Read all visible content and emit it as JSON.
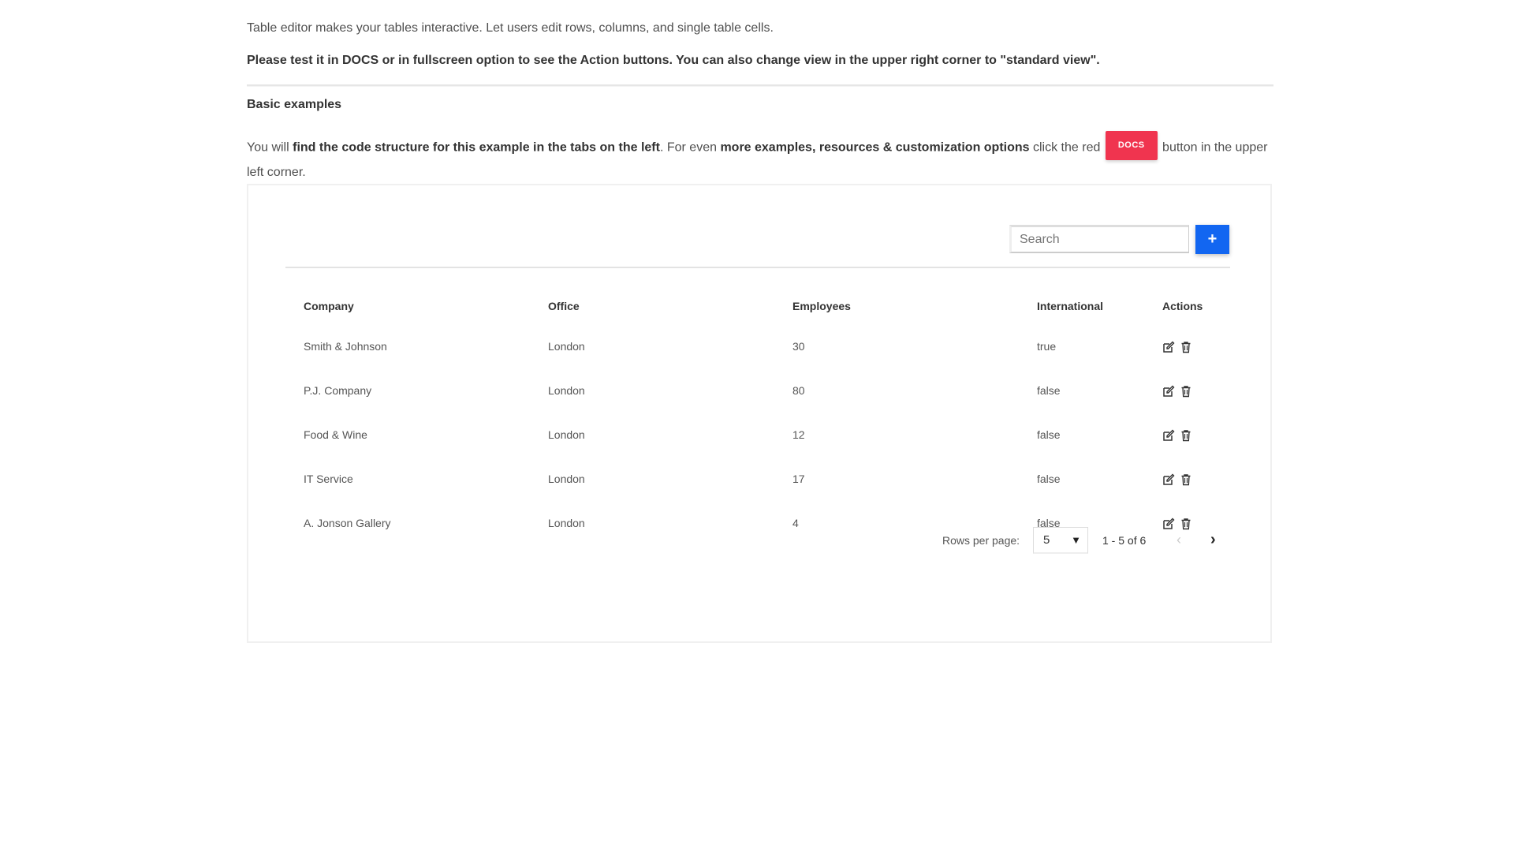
{
  "intro": {
    "line1": "Table editor makes your tables interactive. Let users edit rows, columns, and single table cells.",
    "line2": "Please test it in DOCS or in fullscreen option to see the Action buttons. You can also change view in the upper right corner to \"standard view\"."
  },
  "basic": {
    "heading": "Basic examples",
    "text_a": "You will ",
    "text_b": "find the code structure for this example in the tabs on the left",
    "text_c": ". For even ",
    "text_d": "more examples, resources & customization options",
    "text_e": " click the red ",
    "docs_label": "DOCS",
    "text_f": " button in the upper left corner.",
    "docs_color": "#f0344f"
  },
  "toolbar": {
    "search_placeholder": "Search",
    "add_label": "+",
    "accent": "#1266f1"
  },
  "table": {
    "columns": [
      "Company",
      "Office",
      "Employees",
      "International",
      "Actions"
    ],
    "rows": [
      {
        "company": "Smith & Johnson",
        "office": "London",
        "employees": "30",
        "international": "true"
      },
      {
        "company": "P.J. Company",
        "office": "London",
        "employees": "80",
        "international": "false"
      },
      {
        "company": "Food & Wine",
        "office": "London",
        "employees": "12",
        "international": "false"
      },
      {
        "company": "IT Service",
        "office": "London",
        "employees": "17",
        "international": "false"
      },
      {
        "company": "A. Jonson Gallery",
        "office": "London",
        "employees": "4",
        "international": "false"
      }
    ],
    "action_icons": [
      "edit-icon",
      "trash-icon"
    ]
  },
  "pagination": {
    "rows_per_page_label": "Rows per page:",
    "rows_per_page_value": "5",
    "range": "1 - 5 of 6",
    "prev": "‹",
    "next": "›"
  }
}
